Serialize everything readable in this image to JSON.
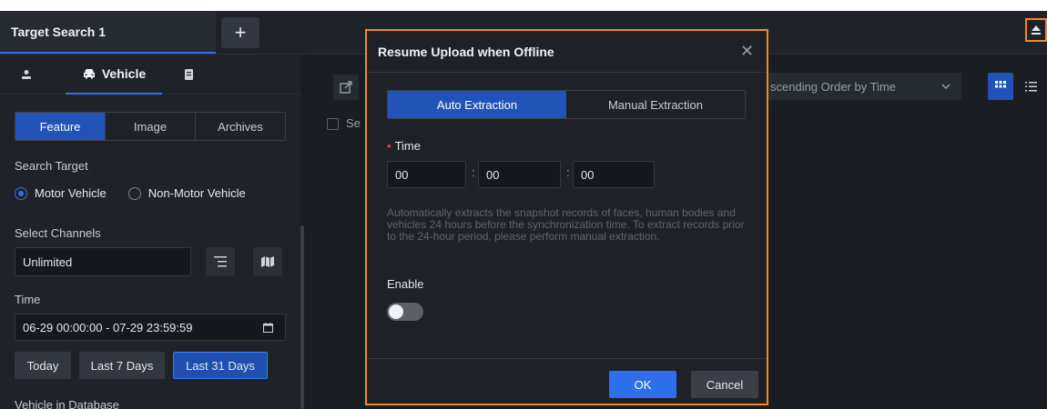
{
  "tabs": {
    "active_label": "Target Search 1",
    "add_label": "+"
  },
  "sidebar": {
    "type_tabs": [
      "Vehicle"
    ],
    "search_modes": [
      "Feature",
      "Image",
      "Archives"
    ],
    "search_target_label": "Search Target",
    "targets": [
      "Motor Vehicle",
      "Non-Motor Vehicle"
    ],
    "select_channels_label": "Select Channels",
    "channels_value": "Unlimited",
    "time_label": "Time",
    "time_range": "06-29 00:00:00 - 07-29 23:59:59",
    "quick_ranges": [
      "Today",
      "Last 7 Days",
      "Last 31 Days"
    ],
    "vehicle_db_label": "Vehicle in Database"
  },
  "main": {
    "sort_value": "scending Order by Time",
    "select_all_fragment": "Se"
  },
  "dialog": {
    "title": "Resume Upload when Offline",
    "modes": [
      "Auto Extraction",
      "Manual Extraction"
    ],
    "time_label": "Time",
    "hours": "00",
    "minutes": "00",
    "seconds": "00",
    "colon": ":",
    "description": "Automatically extracts the snapshot records of faces, human bodies and vehicles 24 hours before the synchronization time. To extract records prior to the 24-hour period, please perform manual extraction.",
    "enable_label": "Enable",
    "enabled": false,
    "ok_label": "OK",
    "cancel_label": "Cancel"
  },
  "colors": {
    "accent": "#2f6fed",
    "highlight": "#f08a24"
  }
}
